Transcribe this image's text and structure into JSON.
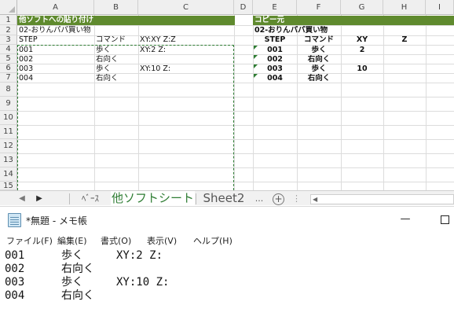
{
  "excel": {
    "columns": [
      "A",
      "B",
      "C",
      "D",
      "E",
      "F",
      "G",
      "H",
      "I"
    ],
    "rows": [
      "1",
      "2",
      "3",
      "4",
      "5",
      "6",
      "7",
      "8",
      "9",
      "10",
      "11",
      "12",
      "13",
      "14",
      "15"
    ],
    "left_block": {
      "title": "他ソフトへの貼り付け",
      "subtitle": "02-おりんパパ買い物",
      "headers": [
        "STEP",
        "コマンド",
        "XY:XY Z:Z"
      ],
      "rows": [
        [
          "001",
          "歩く",
          "XY:2 Z:"
        ],
        [
          "002",
          "右向く",
          ""
        ],
        [
          "003",
          "歩く",
          "XY:10 Z:"
        ],
        [
          "004",
          "右向く",
          ""
        ]
      ]
    },
    "right_block": {
      "title": "コピー元",
      "subtitle": "02-おりんパパ買い物",
      "headers": [
        "STEP",
        "コマンド",
        "XY",
        "Z"
      ],
      "rows": [
        [
          "001",
          "歩く",
          "2",
          ""
        ],
        [
          "002",
          "右向く",
          "",
          ""
        ],
        [
          "003",
          "歩く",
          "10",
          ""
        ],
        [
          "004",
          "右向く",
          "",
          ""
        ]
      ]
    },
    "tabs": {
      "sheet1": "ﾍﾞｰｽ",
      "sheet2": "他ソフトシート",
      "sheet3": "Sheet2",
      "more": "...",
      "add": "+",
      "active": "他ソフトシート"
    },
    "accent_green": "#5f8a2e"
  },
  "notepad": {
    "title": "*無題 - メモ帳",
    "controls": {
      "minimize": "—"
    },
    "menu": [
      "ファイル(F)",
      "編集(E)",
      "書式(O)",
      "表示(V)",
      "ヘルプ(H)"
    ],
    "lines": [
      [
        "001",
        "歩く",
        "XY:2 Z:"
      ],
      [
        "002",
        "右向く",
        ""
      ],
      [
        "003",
        "歩く",
        "XY:10 Z:"
      ],
      [
        "004",
        "右向く",
        ""
      ]
    ]
  }
}
